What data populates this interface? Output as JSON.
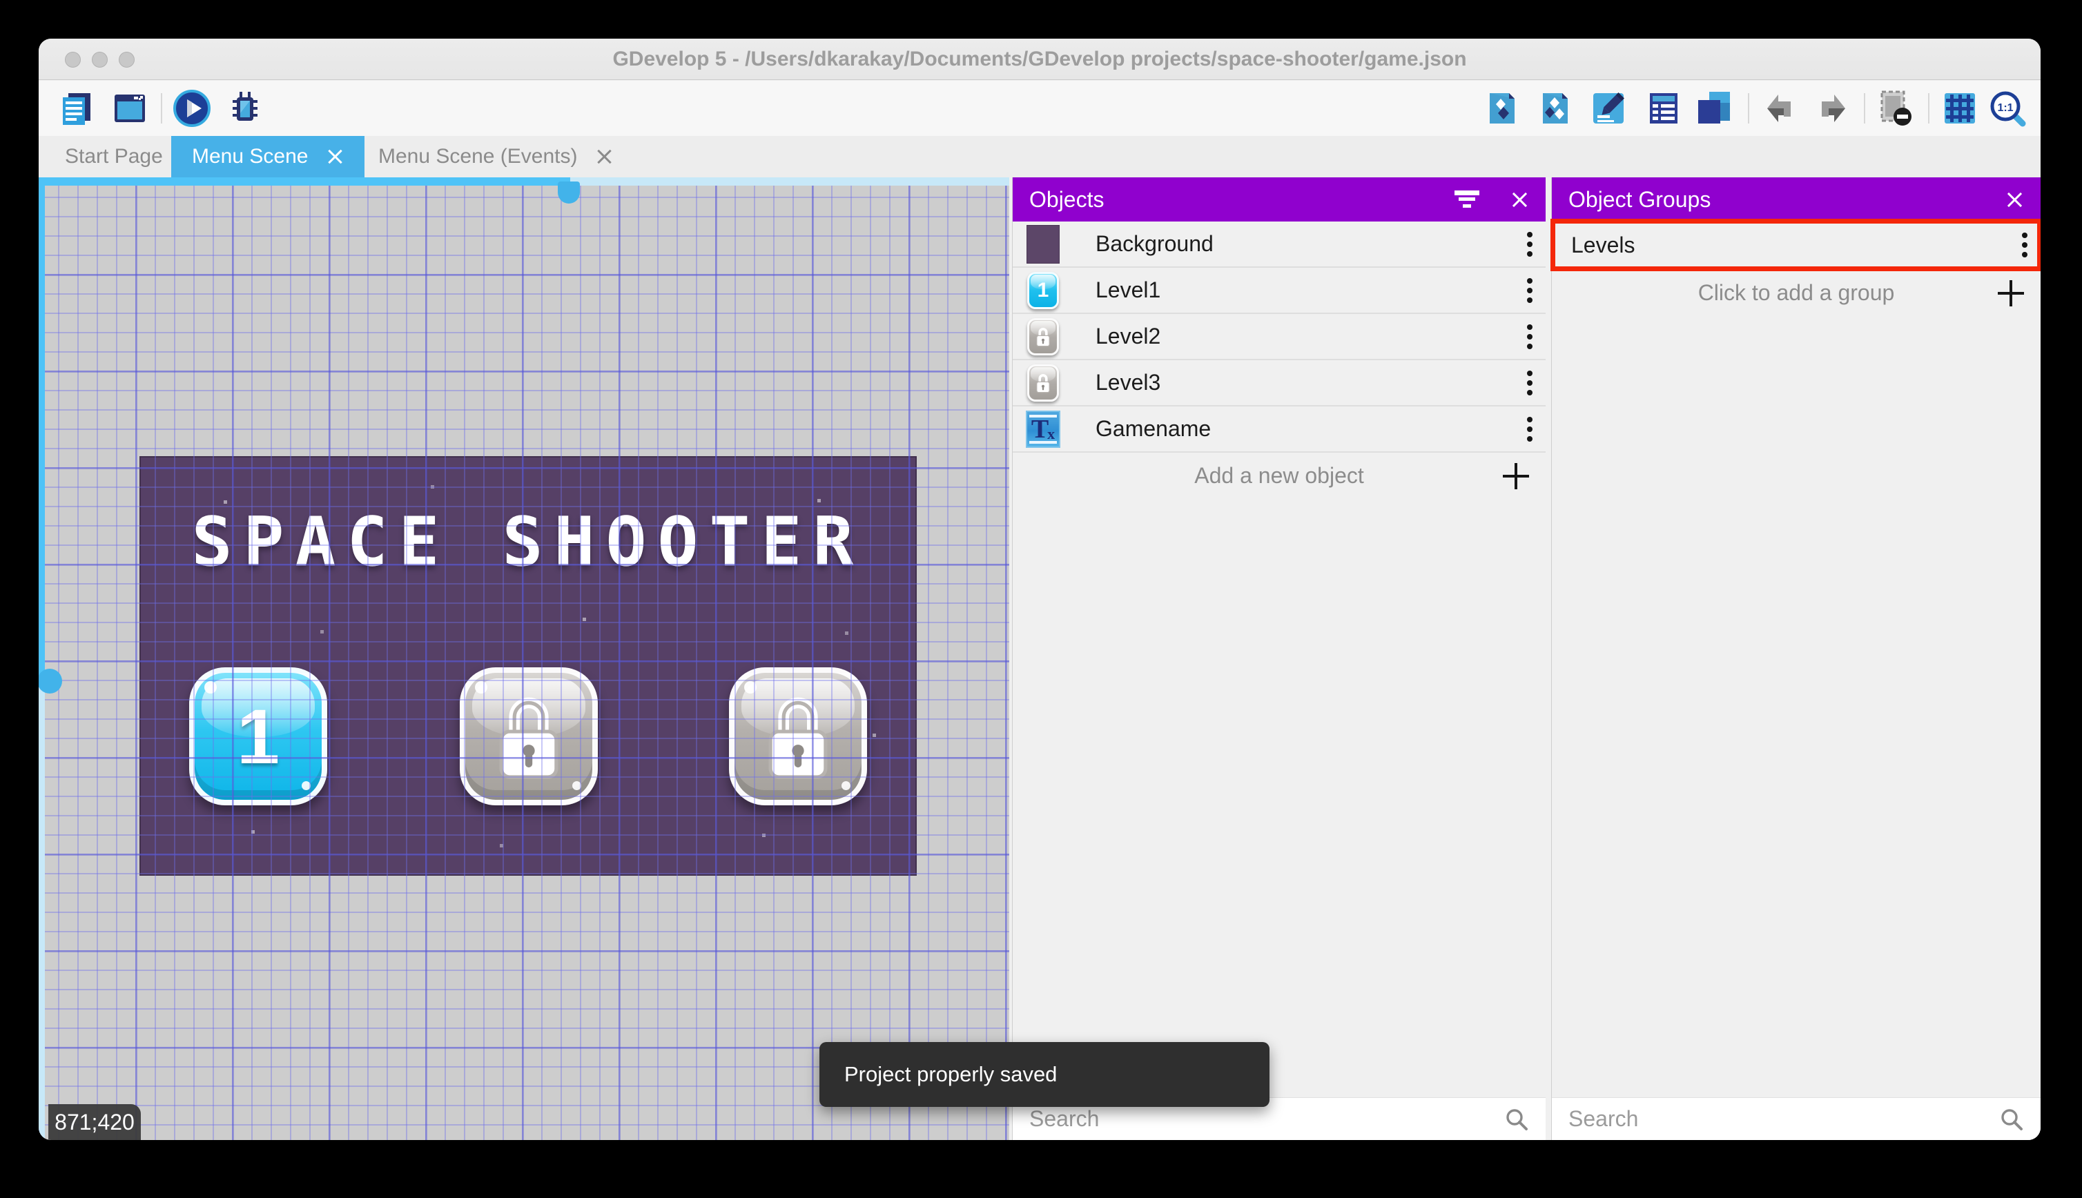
{
  "window": {
    "title": "GDevelop 5 - /Users/dkarakay/Documents/GDevelop projects/space-shooter/game.json"
  },
  "toolbar": {
    "left_icons": [
      "project-manager",
      "preview-window",
      "launch-preview",
      "debugger"
    ],
    "right_icons": [
      "add-object",
      "object-groups",
      "edit-scene",
      "scene-properties",
      "layers",
      "undo",
      "redo",
      "toggle-window-mask",
      "toggle-grid",
      "zoom-original"
    ]
  },
  "tabs": [
    {
      "label": "Start Page",
      "active": false
    },
    {
      "label": "Menu Scene",
      "active": true
    },
    {
      "label": "Menu Scene (Events)",
      "active": false
    }
  ],
  "scene": {
    "title": "SPACE SHOOTER",
    "coordinates": "871;420",
    "buttons": [
      {
        "label": "1",
        "state": "unlocked"
      },
      {
        "label": "",
        "state": "locked"
      },
      {
        "label": "",
        "state": "locked"
      }
    ]
  },
  "objects_panel": {
    "title": "Objects",
    "items": [
      {
        "name": "Background",
        "thumb": "background-sprite"
      },
      {
        "name": "Level1",
        "thumb": "blue-level-button"
      },
      {
        "name": "Level2",
        "thumb": "locked-level-button"
      },
      {
        "name": "Level3",
        "thumb": "locked-level-button"
      },
      {
        "name": "Gamename",
        "thumb": "text-object"
      }
    ],
    "add_label": "Add a new object",
    "search_placeholder": "Search"
  },
  "groups_panel": {
    "title": "Object Groups",
    "groups": [
      {
        "name": "Levels",
        "highlighted": true
      }
    ],
    "add_label": "Click to add a group",
    "search_placeholder": "Search"
  },
  "toast": {
    "message": "Project properly saved"
  },
  "colors": {
    "panel_header": "#9001ce",
    "active_tab": "#47b1e8",
    "highlight_border": "#f4270a",
    "scene_background": "#564066",
    "scrollbar": "#4fc3f7"
  }
}
